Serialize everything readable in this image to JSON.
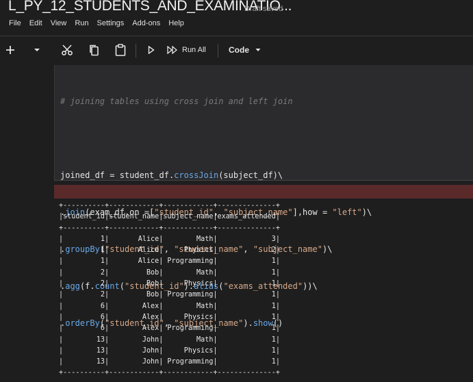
{
  "title": "L_PY_12_STUDENTS_AND_EXAMINATIO...",
  "status": "Draft saved",
  "menu": [
    "File",
    "Edit",
    "View",
    "Run",
    "Settings",
    "Add-ons",
    "Help"
  ],
  "toolbar": {
    "run_all_label": "Run All",
    "cell_type": "Code",
    "icons": [
      "plus-icon",
      "chevron-down-icon",
      "cut-icon",
      "copy-icon",
      "paste-icon",
      "play-icon",
      "fast-forward-icon"
    ]
  },
  "cell": {
    "comment": "# joining tables using cross join and left join",
    "lines": [
      "joined_df = student_df.crossJoin(subject_df)\\",
      ".join(exam_df,on =[\"student_id\", \"subject_name\"],how = \"left\")\\",
      ".groupBy(\"student_id\", \"student_name\", \"subject_name\")\\",
      ".agg(f.count(\"student_id\").alias(\"exams_attended\"))\\",
      ".orderBy(\"student_id\", \"subject_name\").show()"
    ]
  },
  "output": {
    "columns": [
      "student_id",
      "student_name",
      "subject_name",
      "exams_attended"
    ],
    "rows": [
      [
        "1",
        "Alice",
        "Math",
        "3"
      ],
      [
        "1",
        "Alice",
        "Physics",
        "2"
      ],
      [
        "1",
        "Alice",
        "Programming",
        "1"
      ],
      [
        "2",
        "Bob",
        "Math",
        "1"
      ],
      [
        "2",
        "Bob",
        "Physics",
        "1"
      ],
      [
        "2",
        "Bob",
        "Programming",
        "1"
      ],
      [
        "6",
        "Alex",
        "Math",
        "1"
      ],
      [
        "6",
        "Alex",
        "Physics",
        "1"
      ],
      [
        "6",
        "Alex",
        "Programming",
        "1"
      ],
      [
        "13",
        "John",
        "Math",
        "1"
      ],
      [
        "13",
        "John",
        "Physics",
        "1"
      ],
      [
        "13",
        "John",
        "Programming",
        "1"
      ]
    ]
  },
  "colors": {
    "background": "#1e1e1e",
    "cell": "#2b2b2d",
    "output_marker": "#5a2a2a",
    "function": "#6aa9e9",
    "string": "#d7a889",
    "comment": "#7a7a7a"
  }
}
